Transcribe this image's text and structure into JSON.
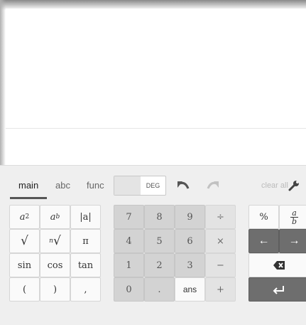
{
  "tabs": [
    {
      "label": "main",
      "active": true
    },
    {
      "label": "abc",
      "active": false
    },
    {
      "label": "func",
      "active": false
    }
  ],
  "angle_toggle": {
    "label": "DEG"
  },
  "clear_all_label": "clear all",
  "keys": {
    "a_squared": {
      "base": "a",
      "exp": "2"
    },
    "a_power_b": {
      "base": "a",
      "exp": "b"
    },
    "abs": "|a|",
    "sqrt": "√",
    "nth_root": {
      "index": "n",
      "radical": "√"
    },
    "pi": "π",
    "sin": "sin",
    "cos": "cos",
    "tan": "tan",
    "open_paren": "(",
    "close_paren": ")",
    "comma": ",",
    "digits": [
      "7",
      "8",
      "9",
      "4",
      "5",
      "6",
      "1",
      "2",
      "3",
      "0",
      "."
    ],
    "divide": "÷",
    "times": "×",
    "minus": "−",
    "plus": "+",
    "ans": "ans",
    "percent": "%",
    "fraction": {
      "num": "a",
      "den": "b"
    },
    "left_arrow": "←",
    "right_arrow": "→"
  },
  "colors": {
    "keypad_bg": "#efefef",
    "digit_key": "#d3d3d3",
    "enter_key": "#6e6e6e"
  }
}
